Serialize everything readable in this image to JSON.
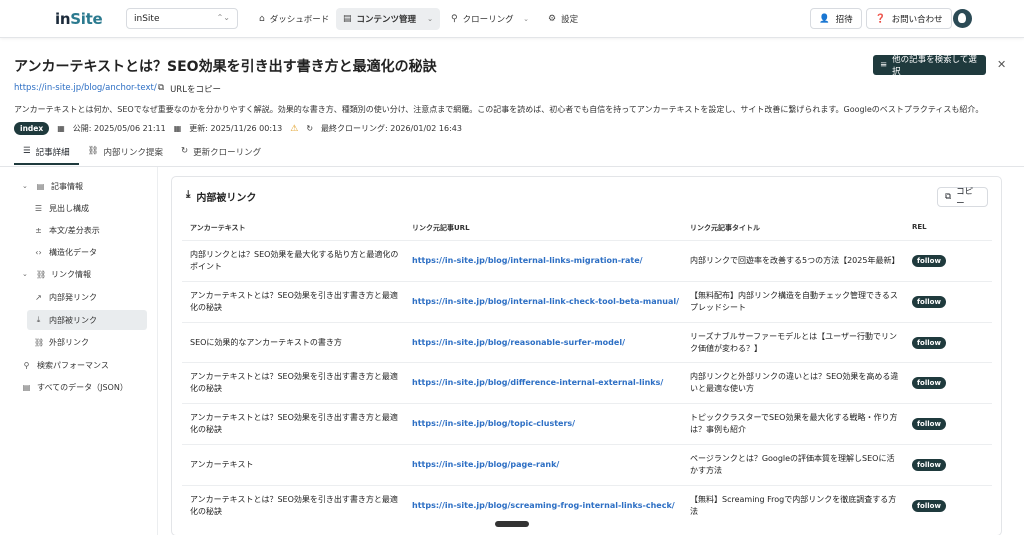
{
  "nav": {
    "logo_in": "in",
    "logo_site": "Site",
    "site_select": "inSite",
    "dashboard": "ダッシュボード",
    "content": "コンテンツ管理",
    "crawling": "クローリング",
    "settings": "設定",
    "invite": "招待",
    "contact": "お問い合わせ"
  },
  "header": {
    "title": "アンカーテキストとは？SEO効果を引き出す書き方と最適化の秘訣",
    "search_button": "他の記事を検索して選択",
    "url": "https://in-site.jp/blog/anchor-text/",
    "copy_url": "URLをコピー",
    "description": "アンカーテキストとは何か、SEOでなぜ重要なのかを分かりやすく解説。効果的な書き方、種類別の使い分け、注意点まで網羅。この記事を読めば、初心者でも自信を持ってアンカーテキストを設定し、サイト改善に繋げられます。Googleのベストプラクティスも紹介。",
    "badge": "index",
    "published": "公開: 2025/05/06 21:11",
    "updated": "更新: 2025/11/26 00:13",
    "last_crawl": "最終クローリング: 2026/01/02 16:43"
  },
  "tabs": [
    "記事詳細",
    "内部リンク提案",
    "更新クローリング"
  ],
  "sidebar": {
    "article_info": "記事情報",
    "headings": "見出し構成",
    "body_diff": "本文/差分表示",
    "structured": "構造化データ",
    "link_info": "リンク情報",
    "outbound": "内部発リンク",
    "inbound": "内部被リンク",
    "external": "外部リンク",
    "search_perf": "検索パフォーマンス",
    "all_data": "すべてのデータ（JSON）"
  },
  "card": {
    "title": "内部被リンク",
    "copy": "コピー",
    "columns": [
      "アンカーテキスト",
      "リンク元記事URL",
      "リンク元記事タイトル",
      "REL"
    ],
    "rows": [
      {
        "anchor": "内部リンクとは？SEO効果を最大化する貼り方と最適化の\nポイント",
        "url": "https://in-site.jp/blog/internal-links-migration-rate/",
        "title": "内部リンクで回遊率を改善する5つの方法【2025年最新】",
        "rel": "follow"
      },
      {
        "anchor": "アンカーテキストとは？SEO効果を引き出す書き方と最適\n化の秘訣",
        "url": "https://in-site.jp/blog/internal-link-check-tool-beta-manual/",
        "title": "【無料配布】内部リンク構造を自動チェック管理できるス\nプレッドシート",
        "rel": "follow"
      },
      {
        "anchor": "SEOに効果的なアンカーテキストの書き方",
        "url": "https://in-site.jp/blog/reasonable-surfer-model/",
        "title": "リーズナブルサーファーモデルとは【ユーザー行動でリン\nク価値が変わる？】",
        "rel": "follow"
      },
      {
        "anchor": "アンカーテキストとは？SEO効果を引き出す書き方と最適\n化の秘訣",
        "url": "https://in-site.jp/blog/difference-internal-external-links/",
        "title": "内部リンクと外部リンクの違いとは？SEO効果を高める違\nいと最適な使い方",
        "rel": "follow"
      },
      {
        "anchor": "アンカーテキストとは？SEO効果を引き出す書き方と最適\n化の秘訣",
        "url": "https://in-site.jp/blog/topic-clusters/",
        "title": "トピッククラスターでSEO効果を最大化する戦略・作り方\nは？事例も紹介",
        "rel": "follow"
      },
      {
        "anchor": "アンカーテキスト",
        "url": "https://in-site.jp/blog/page-rank/",
        "title": "ページランクとは？Googleの評価本質を理解しSEOに活\nかす方法",
        "rel": "follow"
      },
      {
        "anchor": "アンカーテキストとは？SEO効果を引き出す書き方と最適\n化の秘訣",
        "url": "https://in-site.jp/blog/screaming-frog-internal-links-check/",
        "title": "【無料】Screaming Frogで内部リンクを徹底調査する方\n法",
        "rel": "follow"
      }
    ]
  }
}
